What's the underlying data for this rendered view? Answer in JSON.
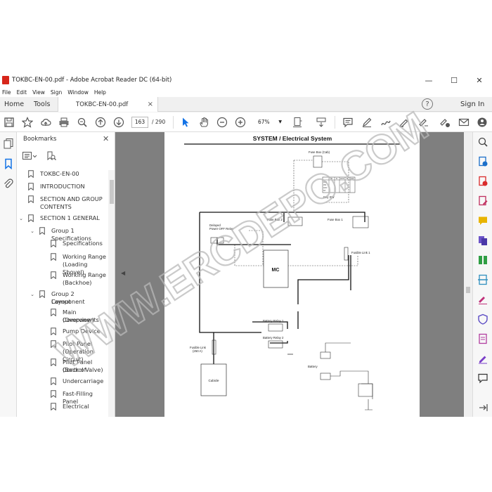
{
  "window": {
    "title": "TOKBC-EN-00.pdf - Adobe Acrobat Reader DC (64-bit)",
    "minimize": "—",
    "maximize": "☐",
    "close": "✕"
  },
  "menu": [
    "File",
    "Edit",
    "View",
    "Sign",
    "Window",
    "Help"
  ],
  "tabs": {
    "home": "Home",
    "tools": "Tools",
    "document": "TOKBC-EN-00.pdf",
    "document_close": "×",
    "help": "?",
    "sign_in": "Sign In"
  },
  "toolbar": {
    "current_page": "163",
    "total_pages": "/ 290",
    "zoom": "67%"
  },
  "bookmarks": {
    "header": "Bookmarks",
    "close": "✕",
    "items": [
      {
        "label": "TOKBC-EN-00",
        "level": 0
      },
      {
        "label": "INTRODUCTION",
        "level": 0
      },
      {
        "label": "SECTION AND GROUP",
        "label2": "CONTENTS",
        "level": 0
      },
      {
        "label": "SECTION 1 GENERAL",
        "level": 0,
        "expanded": true
      },
      {
        "label": "Group 1 Specifications",
        "level": 1,
        "expanded": true
      },
      {
        "label": "Specifications",
        "level": 2
      },
      {
        "label": "Working Range",
        "label2": "(Loading Shovel)",
        "level": 2
      },
      {
        "label": "Working Range",
        "label2": "(Backhoe)",
        "level": 2
      },
      {
        "label": "Group 2 Component",
        "label2": "Layout",
        "level": 1,
        "expanded": true
      },
      {
        "label": "Main Components",
        "label2": "(Overview)",
        "level": 2
      },
      {
        "label": "Pump Device",
        "level": 2
      },
      {
        "label": "Pilot Panel",
        "label2": "(Operation Circuit)",
        "level": 2
      },
      {
        "label": "Pilot Panel (Back of",
        "label2": "Control Valve)",
        "level": 2
      },
      {
        "label": "Undercarriage",
        "level": 2
      },
      {
        "label": "Fast-Filling Panel",
        "level": 2
      },
      {
        "label": "Electrical",
        "level": 2
      }
    ]
  },
  "document": {
    "heading": "SYSTEM / Electrical System",
    "labels": {
      "fuse_box_cab": "Fuse Box (Cab)",
      "key_sw": "Key SW",
      "delayed_relay": "Delayed",
      "delayed_relay2": "Power OFF Relay",
      "fuse_box2": "Fuse Box 2",
      "fuse_box1": "Fuse Box 1",
      "fusible_link1": "Fusible Link 1",
      "mc": "MC",
      "battery_relay1": "Battery Relay 1",
      "battery_relay2": "Battery Relay 2",
      "fusible_link": "Fusible Link",
      "fusible_link_rating": "(250 A)",
      "cubicle": "Cubicle",
      "battery": "Battery",
      "key_table_header": [
        "B",
        "G",
        "ACC",
        "M",
        "ST"
      ],
      "key_table_rows": [
        "OFF",
        "ON",
        "ACC",
        "ST",
        "START"
      ]
    }
  },
  "watermark": "WWW.ERCDEPO.COM",
  "colors": {
    "acrobat_red": "#d7261b",
    "select_blue": "#1473e6",
    "doc_background": "#7f7f7f"
  }
}
